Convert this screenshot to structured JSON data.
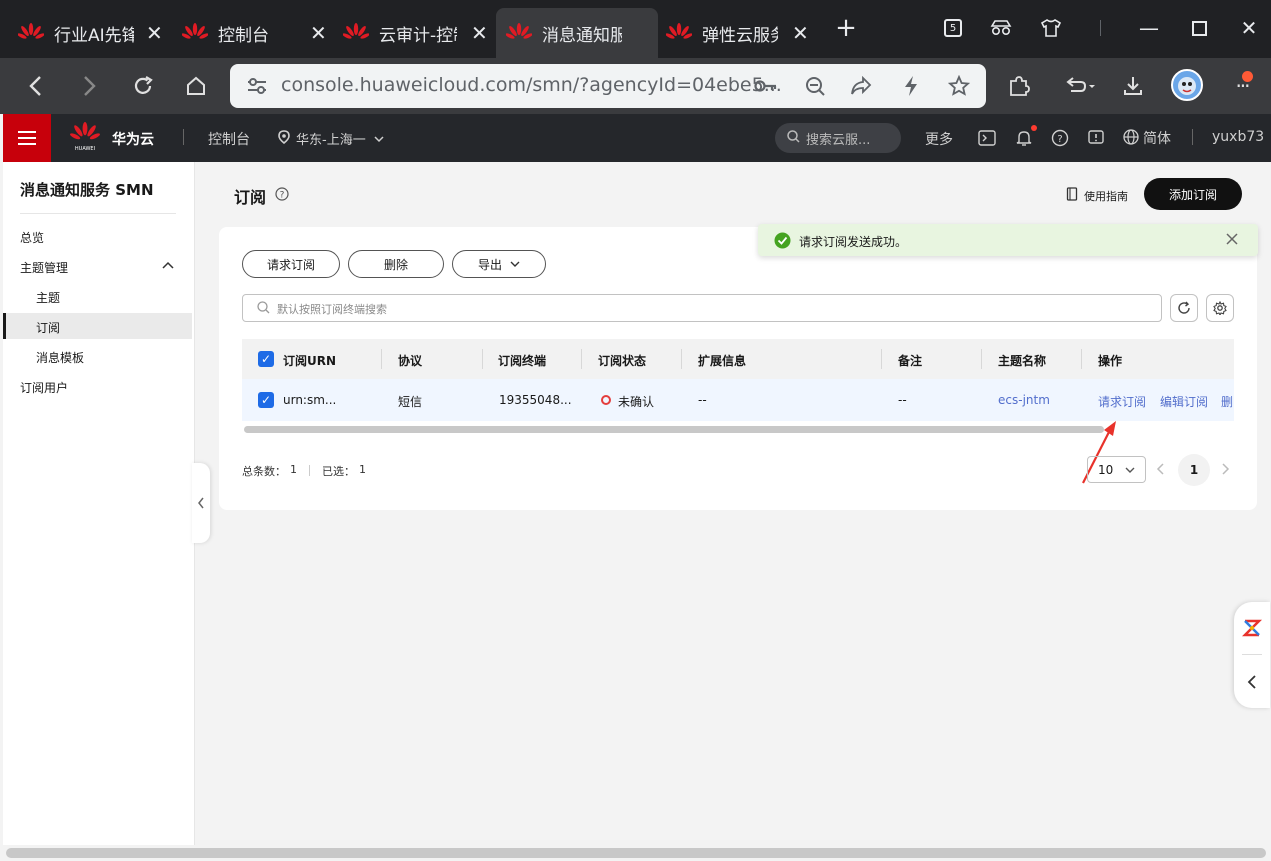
{
  "browser": {
    "tabs": [
      {
        "title": "行业AI先锋"
      },
      {
        "title": "控制台"
      },
      {
        "title": "云审计-控制台"
      },
      {
        "title": "消息通知服务"
      },
      {
        "title": "弹性云服务器"
      }
    ],
    "tab_count_badge": "5",
    "url": "console.huaweicloud.com/smn/?agencyId=04ebe5..."
  },
  "header": {
    "brand": "华为云",
    "brand_sub": "HUAWEI",
    "console": "控制台",
    "region": "华东-上海一",
    "search_placeholder": "搜索云服...",
    "more": "更多",
    "language": "简体",
    "user": "yuxb73"
  },
  "sidebar": {
    "title": "消息通知服务 SMN",
    "items": [
      {
        "label": "总览"
      },
      {
        "label": "主题管理"
      },
      {
        "label": "主题"
      },
      {
        "label": "订阅"
      },
      {
        "label": "消息模板"
      },
      {
        "label": "订阅用户"
      }
    ]
  },
  "page": {
    "title": "订阅",
    "guide": "使用指南",
    "add_button": "添加订阅"
  },
  "toast": {
    "message": "请求订阅发送成功。"
  },
  "toolbar": {
    "request": "请求订阅",
    "delete": "删除",
    "export": "导出"
  },
  "search": {
    "placeholder": "默认按照订阅终端搜索"
  },
  "table": {
    "columns": [
      "订阅URN",
      "协议",
      "订阅终端",
      "订阅状态",
      "扩展信息",
      "备注",
      "主题名称",
      "操作"
    ],
    "rows": [
      {
        "urn": "urn:sm...",
        "protocol": "短信",
        "endpoint": "19355048...",
        "status": "未确认",
        "extra": "--",
        "remark": "--",
        "topic": "ecs-jntm",
        "actions": [
          "请求订阅",
          "编辑订阅",
          "删"
        ]
      }
    ]
  },
  "footer": {
    "total_label": "总条数：",
    "total": "1",
    "selected_label": "已选：",
    "selected": "1",
    "page_size": "10",
    "current_page": "1"
  }
}
